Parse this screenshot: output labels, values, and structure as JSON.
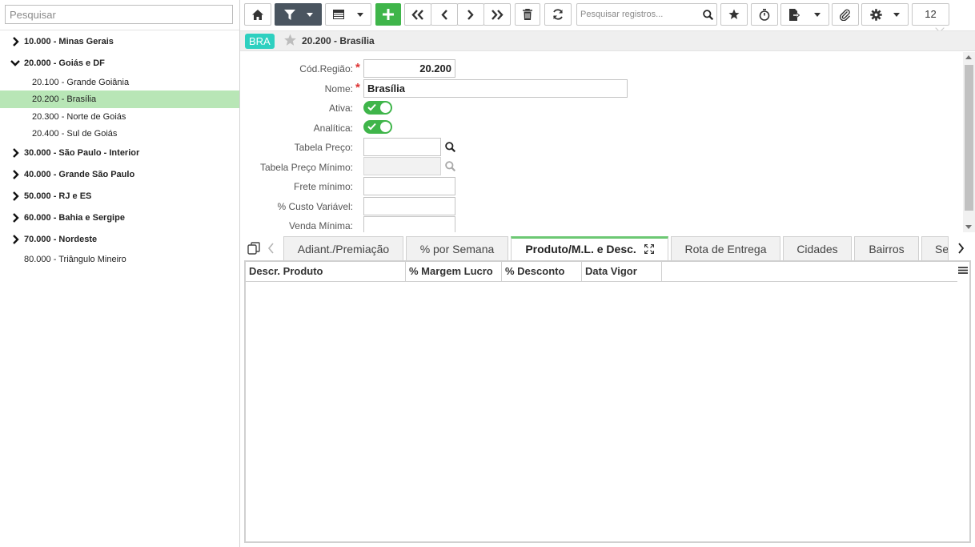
{
  "sidebar": {
    "search_placeholder": "Pesquisar",
    "items": [
      {
        "label": "10.000 - Minas Gerais"
      },
      {
        "label": "20.000 - Goiás e DF"
      },
      {
        "label": "20.100 - Grande Goiânia"
      },
      {
        "label": "20.200 - Brasília"
      },
      {
        "label": "20.300 - Norte de Goiás"
      },
      {
        "label": "20.400 - Sul de Goiás"
      },
      {
        "label": "30.000 - São Paulo - Interior"
      },
      {
        "label": "40.000 - Grande São Paulo"
      },
      {
        "label": "50.000 - RJ e ES"
      },
      {
        "label": "60.000 - Bahia e Sergipe"
      },
      {
        "label": "70.000 - Nordeste"
      },
      {
        "label": "80.000 - Triângulo Mineiro"
      }
    ]
  },
  "toolbar": {
    "icons": [
      "home-icon",
      "filter-icon",
      "table-view-icon",
      "add-icon",
      "first-record-icon",
      "previous-record-icon",
      "next-record-icon",
      "last-record-icon",
      "trash-icon",
      "refresh-icon",
      "search-icon",
      "star-icon",
      "timer-icon",
      "export-icon",
      "paperclip-icon",
      "gear-icon"
    ],
    "record_search_placeholder": "Pesquisar registros...",
    "page_count": "12"
  },
  "record": {
    "badge": "BRA",
    "title": "20.200 - Brasília"
  },
  "form": {
    "cod_regiao_label": "Cód.Região:",
    "cod_regiao_value": "20.200",
    "nome_label": "Nome:",
    "nome_value": "Brasília",
    "ativa_label": "Ativa:",
    "ativa_value": true,
    "analitica_label": "Analítica:",
    "analitica_value": true,
    "tabela_preco_label": "Tabela Preço:",
    "tabela_preco_value": "",
    "tabela_preco_minimo_label": "Tabela Preço Mínimo:",
    "tabela_preco_minimo_value": "",
    "frete_minimo_label": "Frete mínimo:",
    "frete_minimo_value": "",
    "custo_variavel_label": "% Custo Variável:",
    "custo_variavel_value": "",
    "venda_minima_label": "Venda Mínima:",
    "venda_minima_value": ""
  },
  "tabs": [
    {
      "label": "Adiant./Premiação"
    },
    {
      "label": "% por Semana"
    },
    {
      "label": "Produto/M.L. e Desc."
    },
    {
      "label": "Rota de Entrega"
    },
    {
      "label": "Cidades"
    },
    {
      "label": "Bairros"
    },
    {
      "label": "Se"
    }
  ],
  "active_tab": "Produto/M.L. e Desc.",
  "grid": {
    "columns": [
      "Descr. Produto",
      "% Margem Lucro",
      "% Desconto",
      "Data Vigor"
    ],
    "rows": []
  },
  "colors": {
    "accent_green": "#3fb54a",
    "selected_row": "#b8e6b6",
    "badge": "#2ed0c0",
    "toolbar_dark": "#4a5560"
  }
}
